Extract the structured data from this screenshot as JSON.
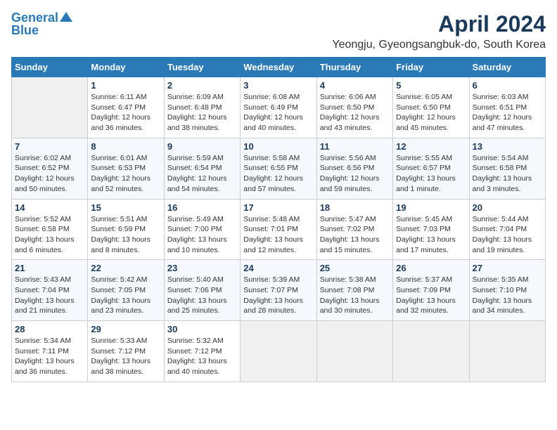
{
  "logo": {
    "line1": "General",
    "line2": "Blue"
  },
  "title": "April 2024",
  "subtitle": "Yeongju, Gyeongsangbuk-do, South Korea",
  "days_of_week": [
    "Sunday",
    "Monday",
    "Tuesday",
    "Wednesday",
    "Thursday",
    "Friday",
    "Saturday"
  ],
  "weeks": [
    [
      {
        "day": "",
        "info": ""
      },
      {
        "day": "1",
        "info": "Sunrise: 6:11 AM\nSunset: 6:47 PM\nDaylight: 12 hours\nand 36 minutes."
      },
      {
        "day": "2",
        "info": "Sunrise: 6:09 AM\nSunset: 6:48 PM\nDaylight: 12 hours\nand 38 minutes."
      },
      {
        "day": "3",
        "info": "Sunrise: 6:08 AM\nSunset: 6:49 PM\nDaylight: 12 hours\nand 40 minutes."
      },
      {
        "day": "4",
        "info": "Sunrise: 6:06 AM\nSunset: 6:50 PM\nDaylight: 12 hours\nand 43 minutes."
      },
      {
        "day": "5",
        "info": "Sunrise: 6:05 AM\nSunset: 6:50 PM\nDaylight: 12 hours\nand 45 minutes."
      },
      {
        "day": "6",
        "info": "Sunrise: 6:03 AM\nSunset: 6:51 PM\nDaylight: 12 hours\nand 47 minutes."
      }
    ],
    [
      {
        "day": "7",
        "info": "Sunrise: 6:02 AM\nSunset: 6:52 PM\nDaylight: 12 hours\nand 50 minutes."
      },
      {
        "day": "8",
        "info": "Sunrise: 6:01 AM\nSunset: 6:53 PM\nDaylight: 12 hours\nand 52 minutes."
      },
      {
        "day": "9",
        "info": "Sunrise: 5:59 AM\nSunset: 6:54 PM\nDaylight: 12 hours\nand 54 minutes."
      },
      {
        "day": "10",
        "info": "Sunrise: 5:58 AM\nSunset: 6:55 PM\nDaylight: 12 hours\nand 57 minutes."
      },
      {
        "day": "11",
        "info": "Sunrise: 5:56 AM\nSunset: 6:56 PM\nDaylight: 12 hours\nand 59 minutes."
      },
      {
        "day": "12",
        "info": "Sunrise: 5:55 AM\nSunset: 6:57 PM\nDaylight: 13 hours\nand 1 minute."
      },
      {
        "day": "13",
        "info": "Sunrise: 5:54 AM\nSunset: 6:58 PM\nDaylight: 13 hours\nand 3 minutes."
      }
    ],
    [
      {
        "day": "14",
        "info": "Sunrise: 5:52 AM\nSunset: 6:58 PM\nDaylight: 13 hours\nand 6 minutes."
      },
      {
        "day": "15",
        "info": "Sunrise: 5:51 AM\nSunset: 6:59 PM\nDaylight: 13 hours\nand 8 minutes."
      },
      {
        "day": "16",
        "info": "Sunrise: 5:49 AM\nSunset: 7:00 PM\nDaylight: 13 hours\nand 10 minutes."
      },
      {
        "day": "17",
        "info": "Sunrise: 5:48 AM\nSunset: 7:01 PM\nDaylight: 13 hours\nand 12 minutes."
      },
      {
        "day": "18",
        "info": "Sunrise: 5:47 AM\nSunset: 7:02 PM\nDaylight: 13 hours\nand 15 minutes."
      },
      {
        "day": "19",
        "info": "Sunrise: 5:45 AM\nSunset: 7:03 PM\nDaylight: 13 hours\nand 17 minutes."
      },
      {
        "day": "20",
        "info": "Sunrise: 5:44 AM\nSunset: 7:04 PM\nDaylight: 13 hours\nand 19 minutes."
      }
    ],
    [
      {
        "day": "21",
        "info": "Sunrise: 5:43 AM\nSunset: 7:04 PM\nDaylight: 13 hours\nand 21 minutes."
      },
      {
        "day": "22",
        "info": "Sunrise: 5:42 AM\nSunset: 7:05 PM\nDaylight: 13 hours\nand 23 minutes."
      },
      {
        "day": "23",
        "info": "Sunrise: 5:40 AM\nSunset: 7:06 PM\nDaylight: 13 hours\nand 25 minutes."
      },
      {
        "day": "24",
        "info": "Sunrise: 5:39 AM\nSunset: 7:07 PM\nDaylight: 13 hours\nand 28 minutes."
      },
      {
        "day": "25",
        "info": "Sunrise: 5:38 AM\nSunset: 7:08 PM\nDaylight: 13 hours\nand 30 minutes."
      },
      {
        "day": "26",
        "info": "Sunrise: 5:37 AM\nSunset: 7:09 PM\nDaylight: 13 hours\nand 32 minutes."
      },
      {
        "day": "27",
        "info": "Sunrise: 5:35 AM\nSunset: 7:10 PM\nDaylight: 13 hours\nand 34 minutes."
      }
    ],
    [
      {
        "day": "28",
        "info": "Sunrise: 5:34 AM\nSunset: 7:11 PM\nDaylight: 13 hours\nand 36 minutes."
      },
      {
        "day": "29",
        "info": "Sunrise: 5:33 AM\nSunset: 7:12 PM\nDaylight: 13 hours\nand 38 minutes."
      },
      {
        "day": "30",
        "info": "Sunrise: 5:32 AM\nSunset: 7:12 PM\nDaylight: 13 hours\nand 40 minutes."
      },
      {
        "day": "",
        "info": ""
      },
      {
        "day": "",
        "info": ""
      },
      {
        "day": "",
        "info": ""
      },
      {
        "day": "",
        "info": ""
      }
    ]
  ]
}
